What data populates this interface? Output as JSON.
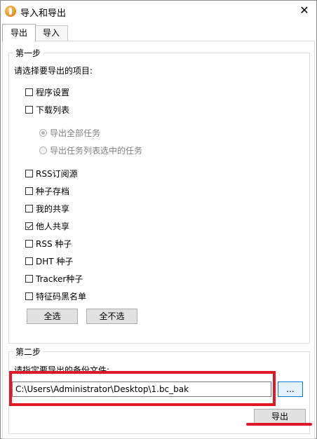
{
  "window": {
    "title": "导入和导出",
    "close_glyph": "✕"
  },
  "tabs": [
    {
      "label": "导出",
      "active": true
    },
    {
      "label": "导入",
      "active": false
    }
  ],
  "step1": {
    "title": "第一步",
    "prompt": "请选择要导出的项目:",
    "items": [
      {
        "label": "程序设置",
        "checked": false
      },
      {
        "label": "下载列表",
        "checked": false
      },
      {
        "label": "RSS订阅源",
        "checked": false
      },
      {
        "label": "种子存档",
        "checked": false
      },
      {
        "label": "我的共享",
        "checked": false
      },
      {
        "label": "他人共享",
        "checked": true
      },
      {
        "label": "RSS 种子",
        "checked": false
      },
      {
        "label": "DHT 种子",
        "checked": false
      },
      {
        "label": "Tracker种子",
        "checked": false
      },
      {
        "label": "特征码黑名单",
        "checked": false
      }
    ],
    "radios": [
      {
        "label": "导出全部任务",
        "selected": true,
        "enabled": false
      },
      {
        "label": "导出任务列表选中的任务",
        "selected": false,
        "enabled": false
      }
    ],
    "select_all_label": "全选",
    "select_none_label": "全不选"
  },
  "step2": {
    "title": "第二步",
    "prompt": "请指定要导出的备份文件:",
    "path_value": "C:\\Users\\Administrator\\Desktop\\1.bc_bak",
    "browse_label": "...",
    "export_label": "导出"
  },
  "colors": {
    "highlight": "#e01727",
    "button_face": "#e1e1e1",
    "focus_border": "#0078d7"
  }
}
